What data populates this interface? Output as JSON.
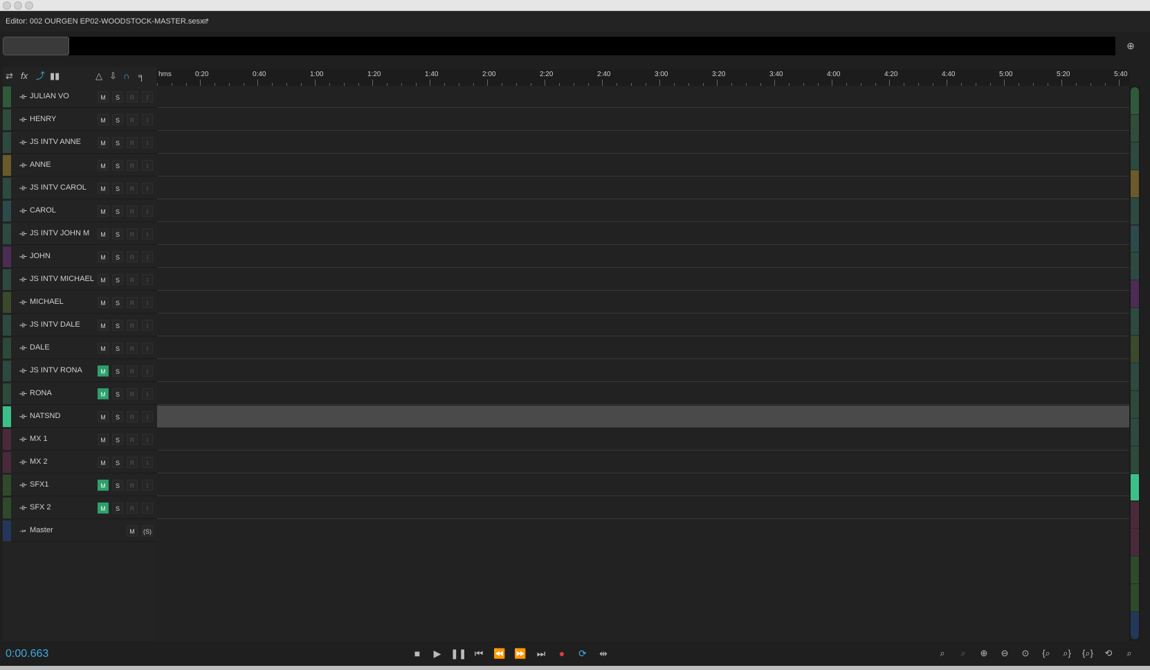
{
  "panel": {
    "title": "Editor: 002 OURGEN EP02-WOODSTOCK-MASTER.sesx *",
    "menu_icon": "hamburger-icon"
  },
  "toolbar": {
    "left_tools": [
      "swap-icon",
      "fx-icon",
      "send-icon",
      "eq-icon"
    ],
    "right_tools": [
      "volume-icon",
      "input-icon",
      "monitor-icon",
      "marker-icon"
    ],
    "fx_label": "fx"
  },
  "ruler": {
    "unit": "hms",
    "labels": [
      "0:20",
      "0:40",
      "1:00",
      "1:20",
      "1:40",
      "2:00",
      "2:20",
      "2:40",
      "3:00",
      "3:20",
      "3:40",
      "4:00",
      "4:20",
      "4:40",
      "5:00",
      "5:20",
      "5:40"
    ]
  },
  "tracks": [
    {
      "name": "JULIAN VO",
      "m": "M",
      "s": "S",
      "r": "R",
      "i": "I",
      "muted": false,
      "color": "#2f5a3a"
    },
    {
      "name": "HENRY",
      "m": "M",
      "s": "S",
      "r": "R",
      "i": "I",
      "muted": false,
      "color": "#2f4d3a"
    },
    {
      "name": "JS INTV ANNE",
      "m": "M",
      "s": "S",
      "r": "R",
      "i": "I",
      "muted": false,
      "color": "#2d4a40"
    },
    {
      "name": "ANNE",
      "m": "M",
      "s": "S",
      "r": "R",
      "i": "I",
      "muted": false,
      "color": "#6b5a2a"
    },
    {
      "name": "JS INTV CAROL",
      "m": "M",
      "s": "S",
      "r": "R",
      "i": "I",
      "muted": false,
      "color": "#2d4a40"
    },
    {
      "name": "CAROL",
      "m": "M",
      "s": "S",
      "r": "R",
      "i": "I",
      "muted": false,
      "color": "#2c4a4a"
    },
    {
      "name": "JS INTV JOHN M",
      "m": "M",
      "s": "S",
      "r": "R",
      "i": "I",
      "muted": false,
      "color": "#2d4a40"
    },
    {
      "name": "JOHN",
      "m": "M",
      "s": "S",
      "r": "R",
      "i": "I",
      "muted": false,
      "color": "#4a2c55"
    },
    {
      "name": "JS INTV MICHAEL",
      "m": "M",
      "s": "S",
      "r": "R",
      "i": "I",
      "muted": false,
      "color": "#2d4a40"
    },
    {
      "name": "MICHAEL",
      "m": "M",
      "s": "S",
      "r": "R",
      "i": "I",
      "muted": false,
      "color": "#3a4a2a"
    },
    {
      "name": "JS INTV DALE",
      "m": "M",
      "s": "S",
      "r": "R",
      "i": "I",
      "muted": false,
      "color": "#2d4a40"
    },
    {
      "name": "DALE",
      "m": "M",
      "s": "S",
      "r": "R",
      "i": "I",
      "muted": false,
      "color": "#2c4a3a"
    },
    {
      "name": "JS INTV RONA",
      "m": "M",
      "s": "S",
      "r": "R",
      "i": "I",
      "muted": true,
      "color": "#2d4a40"
    },
    {
      "name": "RONA",
      "m": "M",
      "s": "S",
      "r": "R",
      "i": "I",
      "muted": true,
      "color": "#2d4a3a"
    },
    {
      "name": "NATSND",
      "m": "M",
      "s": "S",
      "r": "R",
      "i": "I",
      "muted": false,
      "color": "#3cc08a",
      "selected": true
    },
    {
      "name": "MX 1",
      "m": "M",
      "s": "S",
      "r": "R",
      "i": "I",
      "muted": false,
      "color": "#4a2a3a"
    },
    {
      "name": "MX 2",
      "m": "M",
      "s": "S",
      "r": "R",
      "i": "I",
      "muted": false,
      "color": "#4a2a3a"
    },
    {
      "name": "SFX1",
      "m": "M",
      "s": "S",
      "r": "R",
      "i": "I",
      "muted": true,
      "color": "#2f4a2a"
    },
    {
      "name": "SFX 2",
      "m": "M",
      "s": "S",
      "r": "R",
      "i": "I",
      "muted": true,
      "color": "#2f4a2a"
    }
  ],
  "master": {
    "name": "Master",
    "m": "M",
    "s": "(S)",
    "color": "#23375a"
  },
  "transport": {
    "time": "0:00.663",
    "buttons": [
      "stop-icon",
      "play-icon",
      "pause-icon",
      "go-to-start-icon",
      "rewind-icon",
      "fast-forward-icon",
      "go-to-end-icon",
      "record-icon",
      "loop-icon",
      "skip-selection-icon"
    ]
  },
  "zoom_tools": [
    "zoom-in-amplitude-icon",
    "zoom-out-amplitude-icon",
    "zoom-in-time-icon",
    "zoom-out-time-icon",
    "zoom-out-full-icon",
    "zoom-in-point-icon",
    "zoom-in-selection-icon",
    "zoom-to-selection-icon",
    "zoom-reset-icon",
    "zoom-vertical-icon"
  ],
  "colors": {
    "accent": "#3fa9e0",
    "mute_on": "#2e9e6d",
    "record": "#e03c3c"
  }
}
